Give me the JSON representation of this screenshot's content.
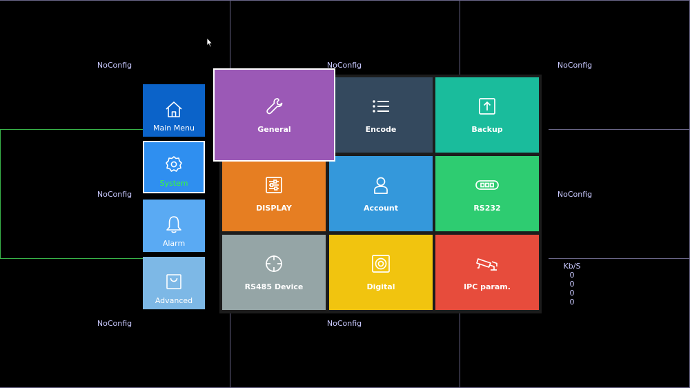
{
  "camera_cells": [
    {
      "label": "NoConfig"
    },
    {
      "label": "NoConfig"
    },
    {
      "label": "NoConfig"
    },
    {
      "label": "NoConfig"
    },
    {
      "label": "NoConfig"
    },
    {
      "label": "NoConfig"
    },
    {
      "label": "NoConfig"
    }
  ],
  "bitrate": {
    "header": "Kb/S",
    "values": [
      "0",
      "0",
      "0",
      "0"
    ]
  },
  "sidebar": {
    "items": [
      {
        "label": "Main Menu",
        "icon": "home-icon",
        "color": "#0b63c9"
      },
      {
        "label": "System",
        "icon": "gear-icon",
        "color": "#2f8ff0",
        "active": true
      },
      {
        "label": "Alarm",
        "icon": "bell-icon",
        "color": "#5aaaf3"
      },
      {
        "label": "Advanced",
        "icon": "bag-icon",
        "color": "#7db8e6"
      }
    ]
  },
  "tiles": [
    {
      "label": "General",
      "icon": "wrench-icon",
      "color": "#9b59b6"
    },
    {
      "label": "Encode",
      "icon": "list-icon",
      "color": "#34495e"
    },
    {
      "label": "Backup",
      "icon": "upload-icon",
      "color": "#1abc9c"
    },
    {
      "label": "DISPLAY",
      "icon": "sliders-icon",
      "color": "#e67e22"
    },
    {
      "label": "Account",
      "icon": "user-icon",
      "color": "#3498db"
    },
    {
      "label": "RS232",
      "icon": "serial-port-icon",
      "color": "#2ecc71"
    },
    {
      "label": "RS485 Device",
      "icon": "crosshair-icon",
      "color": "#95a5a6"
    },
    {
      "label": "Digital",
      "icon": "speaker-icon",
      "color": "#f1c40f"
    },
    {
      "label": "IPC param.",
      "icon": "camera-icon",
      "color": "#e74c3c"
    }
  ]
}
